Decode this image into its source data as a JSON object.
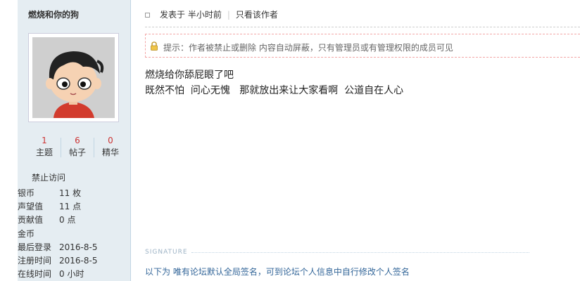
{
  "user": {
    "name": "燃烧和你的狗",
    "stats": [
      {
        "value": "1",
        "label": "主题"
      },
      {
        "value": "6",
        "label": "帖子"
      },
      {
        "value": "0",
        "label": "精华"
      }
    ],
    "status": "禁止访问",
    "info": [
      {
        "key": "银币",
        "value": "11 枚"
      },
      {
        "key": "声望值",
        "value": "11 点"
      },
      {
        "key": "贡献值",
        "value": "0 点"
      },
      {
        "key": "金币",
        "value": ""
      },
      {
        "key": "最后登录",
        "value": "2016-8-5"
      },
      {
        "key": "注册时间",
        "value": "2016-8-5"
      },
      {
        "key": "在线时间",
        "value": "0 小时"
      }
    ]
  },
  "post": {
    "posted_label": "发表于 半小时前",
    "only_author": "只看该作者",
    "notice": "提示：作者被禁止或删除 内容自动屏蔽，只有管理员或有管理权限的成员可见",
    "lines": [
      "燃烧给你舔屁眼了吧",
      "既然不怕  问心无愧   那就放出来让大家看啊  公道自在人心"
    ]
  },
  "signature": {
    "label": "SIGNATURE",
    "text": "以下为 唯有论坛默认全局签名，可到论坛个人信息中自行修改个人签名"
  }
}
